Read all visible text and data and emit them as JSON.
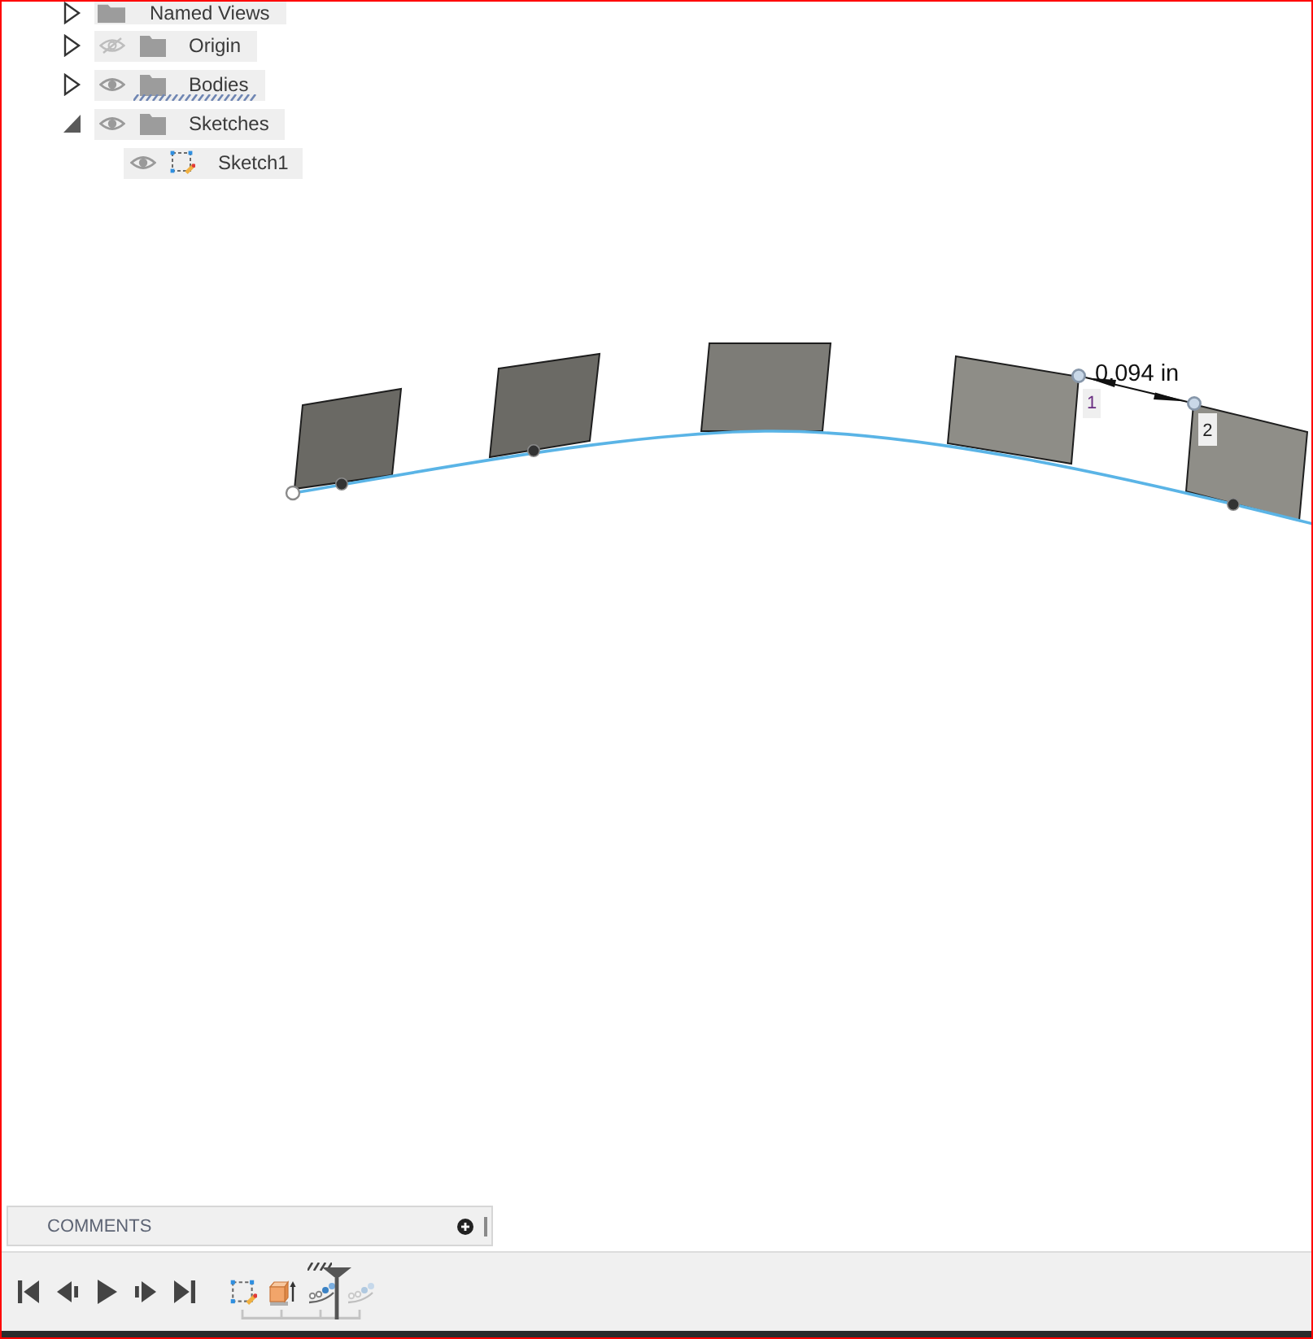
{
  "browser": {
    "named_views": {
      "label": "Named Views",
      "expanded": false
    },
    "items": [
      {
        "label": "Origin",
        "kind": "folder",
        "expanded": false,
        "visible": false,
        "hatched": false
      },
      {
        "label": "Bodies",
        "kind": "folder",
        "expanded": false,
        "visible": true,
        "hatched": true
      },
      {
        "label": "Sketches",
        "kind": "folder",
        "expanded": true,
        "visible": true,
        "hatched": false,
        "children": [
          {
            "label": "Sketch1",
            "kind": "sketch",
            "visible": true
          }
        ]
      }
    ]
  },
  "canvas": {
    "dimension": {
      "value": "0.094 in"
    },
    "point_labels": [
      {
        "label": "1",
        "color": "#6a2f82"
      },
      {
        "label": "2",
        "color": "#222222"
      }
    ]
  },
  "comments": {
    "title": "COMMENTS"
  },
  "timeline": {
    "features": [
      {
        "kind": "sketch",
        "rolled_back": false
      },
      {
        "kind": "extrude",
        "rolled_back": false
      },
      {
        "kind": "pattern",
        "rolled_back": false
      },
      {
        "kind": "pattern",
        "rolled_back": true
      }
    ]
  }
}
